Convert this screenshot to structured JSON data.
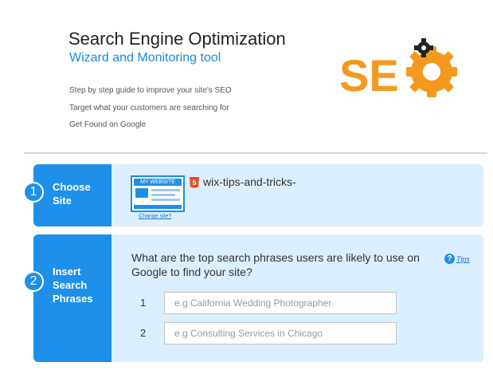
{
  "header": {
    "title": "Search Engine Optimization",
    "subtitle": "Wizard and Monitoring tool",
    "taglines": [
      "Step by step guide to improve your site's SEO",
      "Target what your customers are searching for",
      "Get Found on Google"
    ],
    "logo_text": "SEO"
  },
  "colors": {
    "accent_blue": "#1e90e9",
    "panel_bg": "#dcefff",
    "logo_orange": "#f39a1e"
  },
  "steps": [
    {
      "number": "1",
      "label_lines": [
        "Choose",
        "Site"
      ],
      "thumbnail_label": "MY WEBSITE",
      "change_link": "Change site?",
      "site_name": "wix-tips-and-tricks-",
      "site_icon": "html5-icon"
    },
    {
      "number": "2",
      "label_lines": [
        "Insert",
        "Search",
        "Phrases"
      ],
      "question": "What are the top search phrases users are likely to use on Google to find your site?",
      "tips_label": "Tips",
      "phrases": [
        {
          "number": "1",
          "value": "",
          "placeholder": "e.g California Wedding Photographer"
        },
        {
          "number": "2",
          "value": "",
          "placeholder": "e.g Consulting Services in Chicago"
        }
      ]
    }
  ]
}
